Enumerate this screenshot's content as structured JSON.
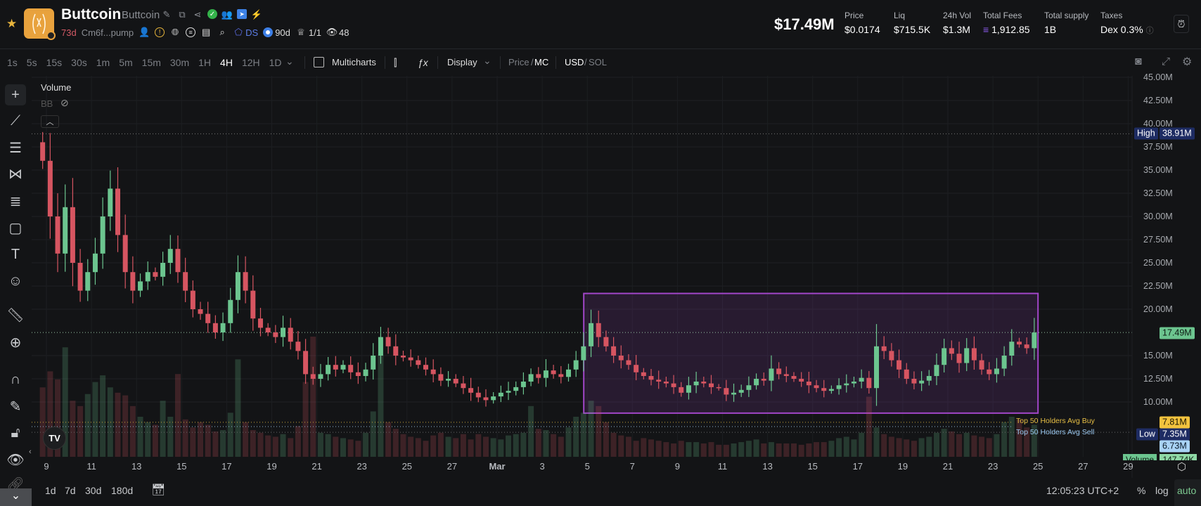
{
  "header": {
    "name": "Buttcoin",
    "symbol_name": "Buttcoin",
    "age": "73d",
    "address": "Cm6f...pump",
    "ds_label": "DS",
    "holders_age": "90d",
    "top_ratio": "1/1",
    "watchers": "48",
    "market_cap": "$17.49M",
    "stats": [
      {
        "label": "Price",
        "value": "$0.0174"
      },
      {
        "label": "Liq",
        "value": "$715.5K"
      },
      {
        "label": "24h Vol",
        "value": "$1.3M"
      },
      {
        "label": "Total Fees",
        "value": "1,912.85"
      },
      {
        "label": "Total supply",
        "value": "1B"
      },
      {
        "label": "Taxes",
        "value": "Dex 0.3%"
      }
    ]
  },
  "toolbar": {
    "intervals": [
      "1s",
      "5s",
      "15s",
      "30s",
      "1m",
      "5m",
      "15m",
      "30m",
      "1H",
      "4H",
      "12H",
      "1D"
    ],
    "active_interval": "4H",
    "multicharts": "Multicharts",
    "display": "Display",
    "price": "Price",
    "mc": "MC",
    "usd": "USD",
    "sol": "SOL",
    "slash": "/"
  },
  "legend": {
    "volume": "Volume",
    "bb": "BB"
  },
  "bottom": {
    "ranges": [
      "1d",
      "7d",
      "30d",
      "180d"
    ],
    "time": "12:05:23 UTC+2",
    "percent": "%",
    "log": "log",
    "auto": "auto"
  },
  "colors": {
    "up": "#6cc58f",
    "down": "#d65561",
    "box": "#a246c9",
    "high_tag": "#1e2c63",
    "price_tag": "#6cc58f",
    "buy_tag": "#f3c33e",
    "sell_tag": "#a9d3f5"
  },
  "chart_data": {
    "type": "candlestick",
    "interval": "8H-approx",
    "start": "Feb 8 16:00",
    "ylim": [
      9,
      45
    ],
    "yticks": [
      "45.00M",
      "42.50M",
      "40.00M",
      "37.50M",
      "35.00M",
      "32.50M",
      "30.00M",
      "27.50M",
      "25.00M",
      "22.50M",
      "20.00M",
      "15.00M",
      "12.50M",
      "10.00M"
    ],
    "ytick_values": [
      45,
      42.5,
      40,
      37.5,
      35,
      32.5,
      30,
      27.5,
      25,
      22.5,
      20,
      15,
      12.5,
      10
    ],
    "xticks": [
      "9",
      "11",
      "13",
      "15",
      "17",
      "19",
      "21",
      "23",
      "25",
      "27",
      "Mar",
      "3",
      "5",
      "7",
      "9",
      "11",
      "13",
      "15",
      "17",
      "19",
      "21",
      "23",
      "25",
      "27",
      "29"
    ],
    "closes": [
      36,
      30,
      26,
      31,
      25,
      22,
      24,
      26,
      30,
      33,
      28,
      24,
      22,
      23,
      24,
      23.5,
      25,
      26.5,
      24,
      22,
      20,
      19.5,
      18.5,
      17.5,
      18.5,
      21,
      24,
      22,
      19,
      18,
      17.5,
      17,
      18,
      16.5,
      15.5,
      13,
      12.5,
      13,
      14,
      13.5,
      14,
      13.2,
      12.8,
      13.5,
      15,
      17,
      16,
      15,
      14.8,
      14.5,
      14,
      13.5,
      13,
      12.3,
      12.5,
      12,
      11.5,
      11,
      10.5,
      10.2,
      10.6,
      11,
      11.2,
      11.6,
      12.2,
      13,
      12.6,
      13.4,
      13,
      12.7,
      13.5,
      14.5,
      16,
      18.5,
      17,
      16,
      15,
      14.5,
      14,
      13.2,
      12.8,
      12.4,
      12.2,
      12,
      11.6,
      11,
      11.8,
      12.2,
      12,
      11.6,
      11.5,
      10.8,
      11,
      11.3,
      11.8,
      12.5,
      12.3,
      13.6,
      13,
      12.8,
      12.5,
      12.2,
      11.8,
      11.5,
      11.2,
      11.4,
      11.8,
      12,
      12.2,
      12.6,
      11.5,
      16,
      15.5,
      14.5,
      13.5,
      12.5,
      12,
      12.3,
      12.8,
      14,
      15.8,
      15.2,
      14.2,
      15.8,
      14.5,
      13.5,
      13,
      13.6,
      15,
      16.5,
      16.2,
      15.8,
      17.49
    ],
    "volumes_k": [
      520,
      640,
      580,
      820,
      420,
      380,
      470,
      560,
      610,
      520,
      480,
      460,
      380,
      300,
      260,
      240,
      420,
      300,
      620,
      280,
      220,
      260,
      240,
      190,
      200,
      330,
      730,
      260,
      200,
      180,
      160,
      150,
      170,
      140,
      230,
      560,
      900,
      180,
      170,
      150,
      140,
      130,
      120,
      180,
      340,
      760,
      260,
      210,
      170,
      150,
      140,
      120,
      160,
      180,
      150,
      140,
      170,
      130,
      170,
      150,
      140,
      130,
      160,
      170,
      180,
      380,
      210,
      200,
      170,
      150,
      220,
      300,
      330,
      420,
      380,
      260,
      180,
      160,
      150,
      120,
      140,
      130,
      120,
      110,
      100,
      120,
      110,
      110,
      100,
      110,
      90,
      90,
      100,
      110,
      120,
      130,
      100,
      110,
      100,
      100,
      100,
      90,
      100,
      110,
      110,
      120,
      140,
      150,
      130,
      180,
      450,
      220,
      170,
      150,
      140,
      130,
      120,
      140,
      150,
      180,
      210,
      190,
      170,
      180,
      160,
      150,
      140,
      170,
      260,
      300,
      280,
      220,
      240
    ],
    "last_volume": "147.74K",
    "high": {
      "label": "High",
      "value": "38.91M",
      "v": 38.91
    },
    "current": {
      "value": "17.49M",
      "v": 17.49
    },
    "low": {
      "label": "Low",
      "value": "7.35M",
      "v": 7.35
    },
    "extra_tag": {
      "value": "6.73M",
      "v": 6.73
    },
    "avg_buy": {
      "label": "Top 50 Holders Avg Buy",
      "value": "7.81M",
      "v": 7.81
    },
    "avg_sell": {
      "label": "Top 50 Holders Avg Sell",
      "value": "7.35M",
      "v": 7.35
    },
    "volume_label": "Volume",
    "range_box": {
      "from": "Mar 5",
      "to": "Mar 25",
      "top": 21.7,
      "bottom": 8.8
    }
  }
}
